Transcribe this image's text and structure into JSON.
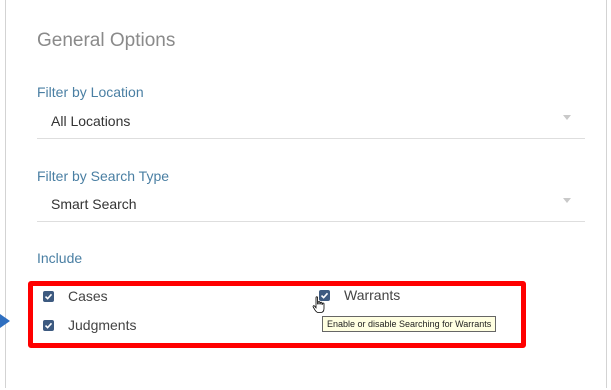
{
  "title": "General Options",
  "location": {
    "label": "Filter by Location",
    "value": "All Locations"
  },
  "search_type": {
    "label": "Filter by Search Type",
    "value": "Smart Search"
  },
  "include": {
    "label": "Include",
    "options": [
      {
        "label": "Cases",
        "checked": true
      },
      {
        "label": "Warrants",
        "checked": true
      },
      {
        "label": "Judgments",
        "checked": true
      }
    ]
  },
  "tooltip": "Enable or disable Searching for Warrants",
  "colors": {
    "checkbox": "#3d5a80",
    "highlight": "#ff0000",
    "label": "#4a7fa3"
  }
}
